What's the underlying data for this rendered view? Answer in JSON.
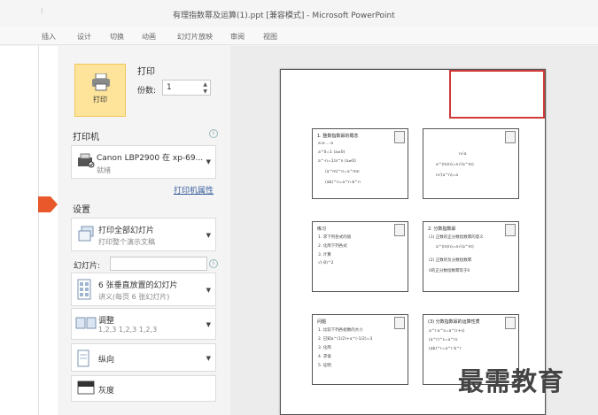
{
  "window": {
    "title": "有理指数幂及运算(1).ppt [兼容模式] - Microsoft PowerPoint"
  },
  "menu": [
    "插入",
    "设计",
    "切换",
    "动画",
    "幻灯片放映",
    "审阅",
    "视图"
  ],
  "print": {
    "heading": "打印",
    "button_label": "打印",
    "copies_label": "份数:",
    "copies_value": "1"
  },
  "printer": {
    "heading": "打印机",
    "name": "Canon LBP2900 在 xp-69...",
    "status": "就绪",
    "properties_link": "打印机属性"
  },
  "settings": {
    "heading": "设置",
    "range_main": "打印全部幻灯片",
    "range_sub": "打印整个演示文稿",
    "slides_label": "幻灯片:",
    "slides_value": "",
    "layout_main": "6 张垂直放置的幻灯片",
    "layout_sub": "讲义(每页 6 张幻灯片)",
    "collate_main": "调整",
    "collate_sub": "1,2,3    1,2,3    1,2,3",
    "orientation_main": "纵向",
    "color_main": "灰度"
  },
  "preview": {
    "thumbs": [
      {
        "title": "1. 整数指数幂的概念",
        "lines": [
          "a·a·…·a",
          "a^0=1 (a≠0)",
          "a^-n=1/a^n (a≠0)",
          "(a^m)^n=a^mn",
          "(ab)^n=a^n b^n"
        ]
      },
      {
        "title": "",
        "lines": [
          "n√a",
          "a^(m/n)=n√(a^m)",
          "n√(a^n)=a"
        ]
      },
      {
        "title": "练习",
        "lines": [
          "1. 求下列各式的值",
          "2. 化简下列各式",
          "3. 计算",
          "√(-8)^2"
        ]
      },
      {
        "title": "2. 分数指数幂",
        "lines": [
          "(1) 正数的正分数指数幂的意义",
          "a^(m/n)=n√(a^m)",
          "(2) 正数的负分数指数幂",
          "0的正分数指数幂等于0"
        ]
      },
      {
        "title": "问题",
        "lines": [
          "1. 比较下列各组数的大小",
          "2. 已知a^(1/2)+a^(-1/2)=3",
          "3. 化简",
          "4. 求值",
          "5. 证明"
        ]
      },
      {
        "title": "(3) 分数指数幂的运算性质",
        "lines": [
          "a^r·a^s=a^(r+s)",
          "(a^r)^s=a^rs",
          "(ab)^r=a^r b^r"
        ]
      }
    ]
  },
  "watermark": "最需教育"
}
